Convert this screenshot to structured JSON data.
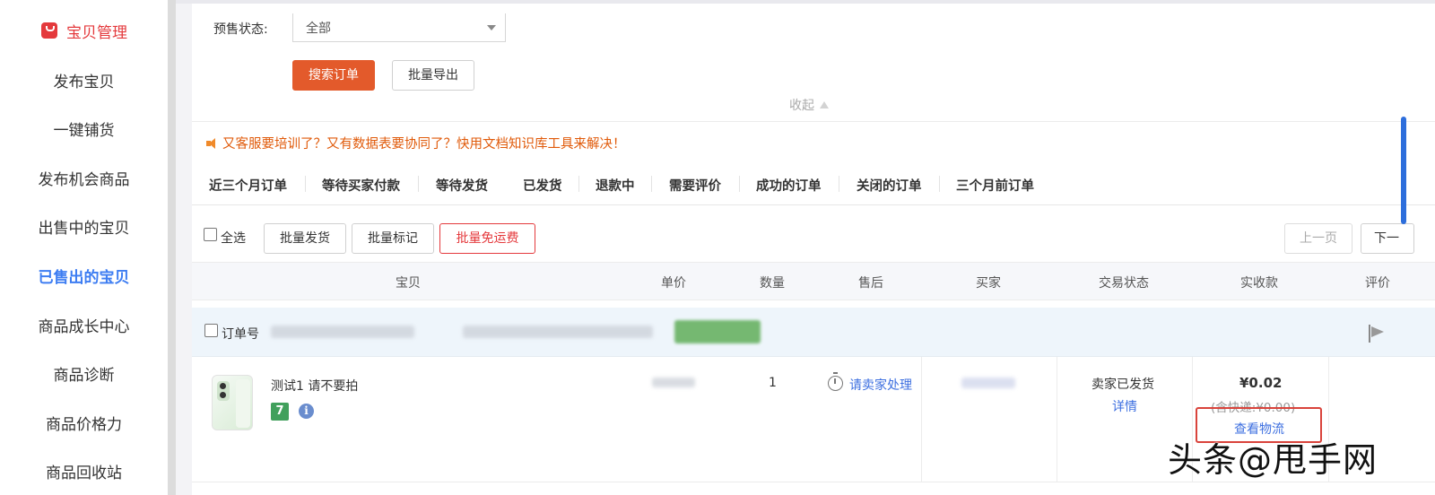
{
  "sidebar": {
    "section_title": "宝贝管理",
    "items": [
      {
        "label": "发布宝贝"
      },
      {
        "label": "一键铺货"
      },
      {
        "label": "发布机会商品"
      },
      {
        "label": "出售中的宝贝"
      },
      {
        "label": "已售出的宝贝",
        "active": true
      },
      {
        "label": "商品成长中心"
      },
      {
        "label": "商品诊断"
      },
      {
        "label": "商品价格力"
      },
      {
        "label": "商品回收站"
      }
    ]
  },
  "filter": {
    "presale_label": "预售状态:",
    "presale_value": "全部",
    "search_button": "搜索订单",
    "export_button": "批量导出",
    "collapse_label": "收起"
  },
  "notice": "又客服要培训了？又有数据表要协同了？快用文档知识库工具来解决！",
  "tabs": [
    {
      "label": "近三个月订单"
    },
    {
      "label": "等待买家付款"
    },
    {
      "label": "等待发货"
    },
    {
      "label": "已发货",
      "active": true
    },
    {
      "label": "退款中"
    },
    {
      "label": "需要评价"
    },
    {
      "label": "成功的订单"
    },
    {
      "label": "关闭的订单"
    },
    {
      "label": "三个月前订单"
    }
  ],
  "toolbar": {
    "select_all": "全选",
    "batch_ship": "批量发货",
    "batch_mark": "批量标记",
    "batch_free_shipping": "批量免运费",
    "prev_page": "上一页",
    "next_page": "下一"
  },
  "table": {
    "columns": [
      "宝贝",
      "单价",
      "数量",
      "售后",
      "买家",
      "交易状态",
      "实收款",
      "评价"
    ]
  },
  "order": {
    "order_no_label": "订单号",
    "item_title": "测试1 请不要拍",
    "badge_seven": "7",
    "info_symbol": "i",
    "quantity": "1",
    "after_sale": "请卖家处理",
    "status": "卖家已发货",
    "detail_link": "详情",
    "amount": "¥0.02",
    "shipping_note": "(含快递:¥0.00)",
    "logistics_link": "查看物流"
  },
  "watermark": "头条@甩手网"
}
